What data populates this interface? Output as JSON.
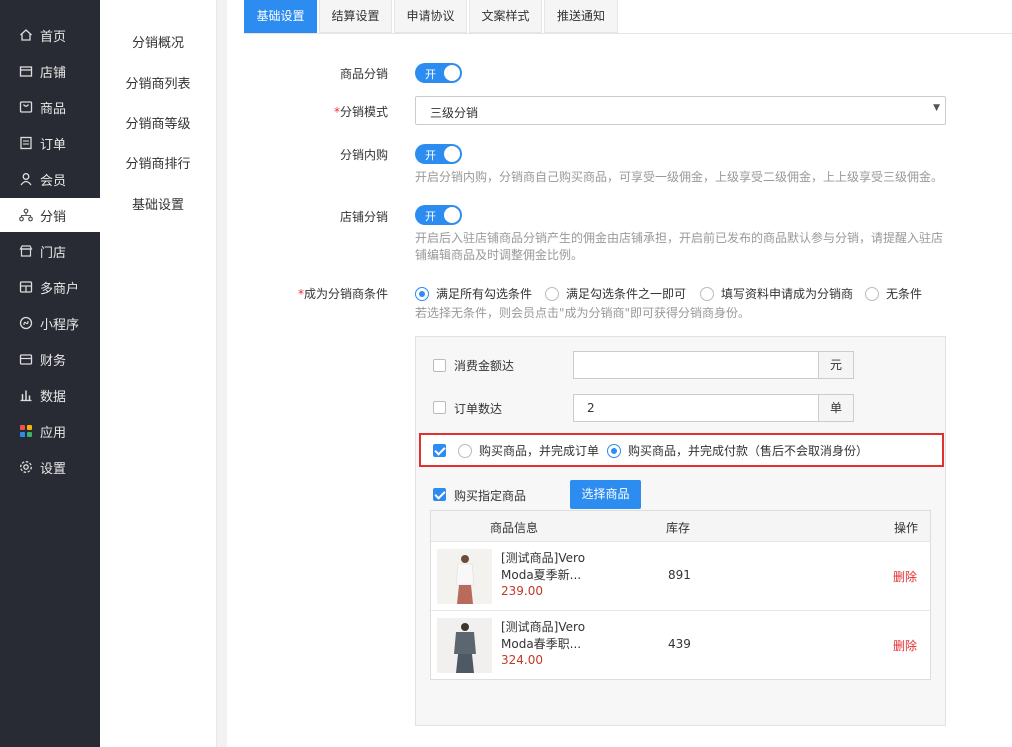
{
  "sidebar": {
    "items": [
      {
        "label": "首页",
        "icon": "home-icon"
      },
      {
        "label": "店铺",
        "icon": "store-icon"
      },
      {
        "label": "商品",
        "icon": "goods-icon"
      },
      {
        "label": "订单",
        "icon": "order-icon"
      },
      {
        "label": "会员",
        "icon": "member-icon"
      },
      {
        "label": "分销",
        "icon": "distribution-icon"
      },
      {
        "label": "门店",
        "icon": "shop-icon"
      },
      {
        "label": "多商户",
        "icon": "multi-merchant-icon"
      },
      {
        "label": "小程序",
        "icon": "miniprogram-icon"
      },
      {
        "label": "财务",
        "icon": "finance-icon"
      },
      {
        "label": "数据",
        "icon": "data-icon"
      },
      {
        "label": "应用",
        "icon": "apps-icon"
      },
      {
        "label": "设置",
        "icon": "settings-icon"
      }
    ],
    "active": "分销"
  },
  "submenu": {
    "items": [
      "分销概况",
      "分销商列表",
      "分销商等级",
      "分销商排行",
      "基础设置"
    ]
  },
  "tabs": [
    "基础设置",
    "结算设置",
    "申请协议",
    "文案样式",
    "推送通知"
  ],
  "active_tab": "基础设置",
  "form": {
    "goods_distribution": {
      "label": "商品分销",
      "switch": "开"
    },
    "mode": {
      "label": "分销模式",
      "value": "三级分销"
    },
    "self_purchase": {
      "label": "分销内购",
      "switch": "开",
      "help": "开启分销内购，分销商自己购买商品，可享受一级佣金，上级享受二级佣金，上上级享受三级佣金。"
    },
    "store_distribution": {
      "label": "店铺分销",
      "switch": "开",
      "help_line1": "开启后入驻店铺商品分销产生的佣金由店铺承担，开启前已发布的商品默认参与分销，请提醒入驻店",
      "help_line2": "铺编辑商品及时调整佣金比例。"
    },
    "condition": {
      "label": "成为分销商条件",
      "options": [
        "满足所有勾选条件",
        "满足勾选条件之一即可",
        "填写资料申请成为分销商",
        "无条件"
      ],
      "selected": "满足所有勾选条件",
      "help": "若选择无条件，则会员点击\"成为分销商\"即可获得分销商身份。"
    }
  },
  "panel": {
    "spend_amount": {
      "label": "消费金额达",
      "value": "",
      "unit": "元",
      "checked": false
    },
    "order_count": {
      "label": "订单数达",
      "value": "2",
      "unit": "单",
      "checked": false
    },
    "purchase": {
      "checked": true,
      "options": [
        "购买商品，并完成订单",
        "购买商品，并完成付款（售后不会取消身份）"
      ],
      "selected": "购买商品，并完成付款（售后不会取消身份）"
    },
    "specific_goods": {
      "label": "购买指定商品",
      "checked": true,
      "button": "选择商品"
    },
    "table": {
      "headers": [
        "商品信息",
        "库存",
        "操作"
      ],
      "rows": [
        {
          "name_line1": "[测试商品]Vero",
          "name_line2": "Moda夏季新...",
          "price": "239.00",
          "stock": "891",
          "action": "删除"
        },
        {
          "name_line1": "[测试商品]Vero",
          "name_line2": "Moda春季职...",
          "price": "324.00",
          "stock": "439",
          "action": "删除"
        }
      ]
    }
  },
  "colors": {
    "primary": "#2d8cf0",
    "sidebar": "#282b33",
    "highlight_border": "#e0302f",
    "danger": "#e0302f"
  }
}
